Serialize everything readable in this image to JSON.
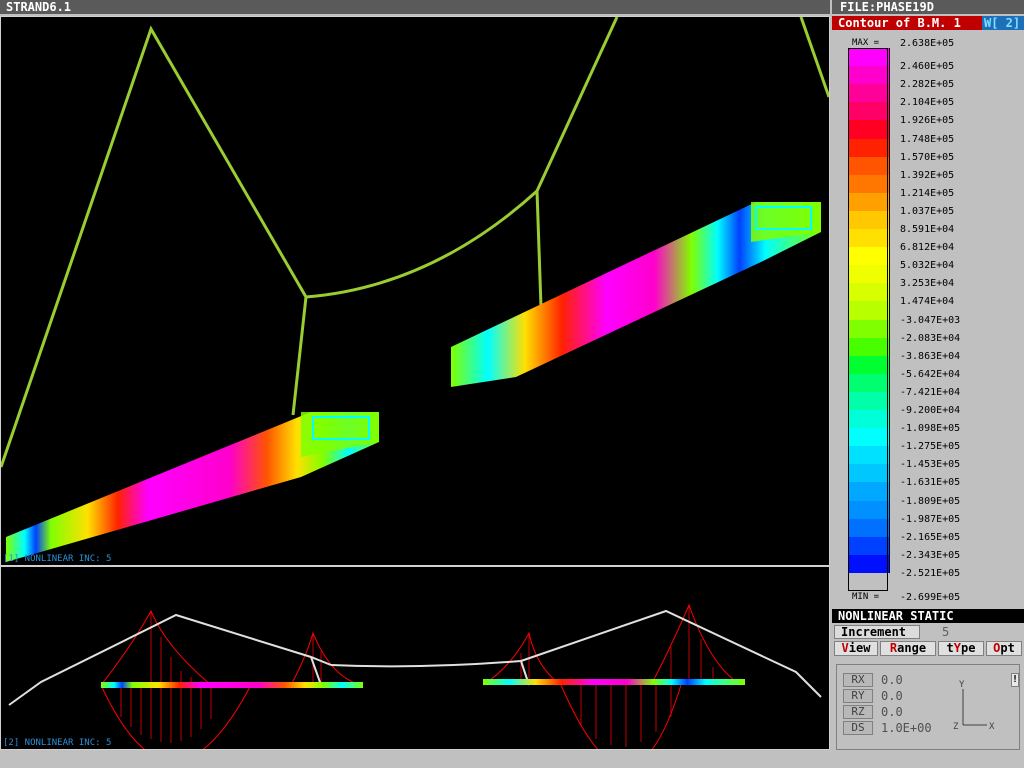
{
  "app": {
    "title": "STRAND6.1",
    "file": "FILE:PHASE19D"
  },
  "contour": {
    "title": "Contour of B.M. 1",
    "window": "W[ 2]"
  },
  "legend": {
    "max_label": "MAX =",
    "max_value": "2.638E+05",
    "min_label": "MIN =",
    "min_value": "-2.699E+05",
    "levels": [
      "2.460E+05",
      "2.282E+05",
      "2.104E+05",
      "1.926E+05",
      "1.748E+05",
      "1.570E+05",
      "1.392E+05",
      "1.214E+05",
      "1.037E+05",
      "8.591E+04",
      "6.812E+04",
      "5.032E+04",
      "3.253E+04",
      "1.474E+04",
      "-3.047E+03",
      "-2.083E+04",
      "-3.863E+04",
      "-5.642E+04",
      "-7.421E+04",
      "-9.200E+04",
      "-1.098E+05",
      "-1.275E+05",
      "-1.453E+05",
      "-1.631E+05",
      "-1.809E+05",
      "-1.987E+05",
      "-2.165E+05",
      "-2.343E+05",
      "-2.521E+05"
    ],
    "colors": [
      "#ff00ff",
      "#ff00cc",
      "#ff0099",
      "#ff0066",
      "#ff0022",
      "#ff2200",
      "#ff5500",
      "#ff7700",
      "#ffa000",
      "#ffc800",
      "#ffe000",
      "#ffff00",
      "#f0ff00",
      "#d8ff00",
      "#b8ff00",
      "#80ff00",
      "#48ff00",
      "#00ff30",
      "#00ff70",
      "#00ffa8",
      "#00ffd8",
      "#00ffff",
      "#00e0ff",
      "#00c8ff",
      "#00a8ff",
      "#0090ff",
      "#0070ff",
      "#0040ff",
      "#0010ff"
    ]
  },
  "views": {
    "main_label": "[1] NONLINEAR INC: 5",
    "sub_label": "[2] NONLINEAR INC: 5"
  },
  "panel": {
    "analysis": "NONLINEAR STATIC",
    "increment_label": "Increment",
    "increment_value": "5",
    "menu": [
      {
        "pre": "",
        "hot": "V",
        "post": "iew"
      },
      {
        "pre": "",
        "hot": "R",
        "post": "ange"
      },
      {
        "pre": "t",
        "hot": "Y",
        "post": "pe"
      },
      {
        "pre": "",
        "hot": "O",
        "post": "pt"
      }
    ],
    "rotations": [
      {
        "label": "RX",
        "value": "0.0"
      },
      {
        "label": "RY",
        "value": "0.0"
      },
      {
        "label": "RZ",
        "value": "0.0"
      },
      {
        "label": "DS",
        "value": "1.0E+00"
      }
    ],
    "axes": {
      "y": "Y",
      "z": "Z",
      "x": "X"
    },
    "scroll_mark": "!"
  }
}
